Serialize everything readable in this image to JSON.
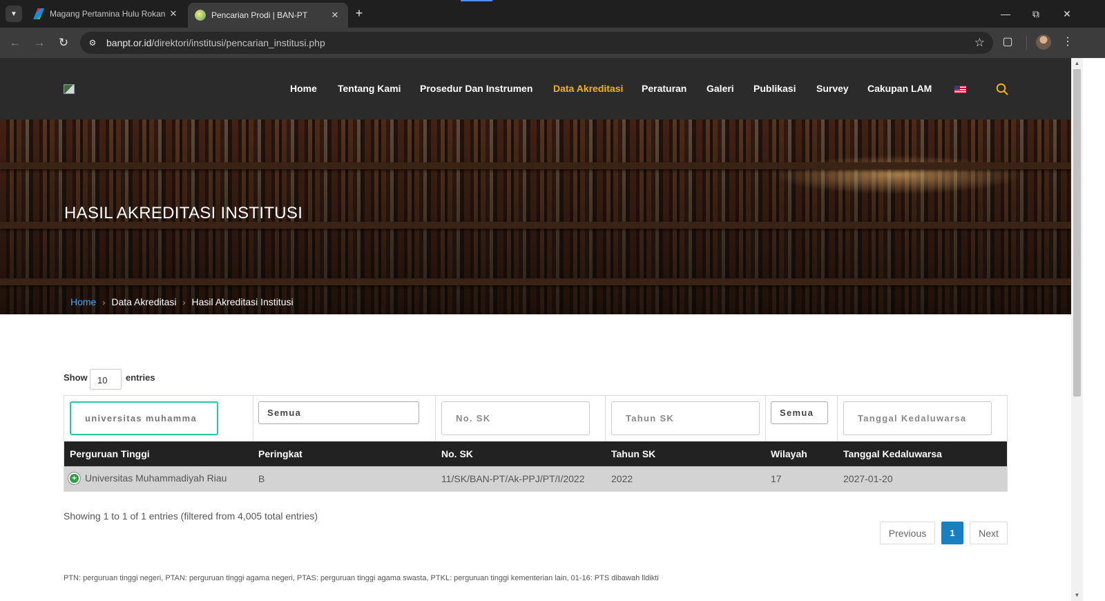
{
  "browser": {
    "tabs": [
      {
        "title": "Magang Pertamina Hulu Rokan",
        "active": false
      },
      {
        "title": "Pencarian Prodi | BAN-PT",
        "active": true
      }
    ],
    "new_tab": "+",
    "url_host": "banpt.or.id",
    "url_path": "/direktori/institusi/pencarian_institusi.php"
  },
  "site": {
    "nav": [
      "Home",
      "Tentang Kami",
      "Prosedur Dan Instrumen",
      "Data Akreditasi",
      "Peraturan",
      "Galeri",
      "Publikasi",
      "Survey",
      "Cakupan LAM"
    ],
    "active_nav": "Data Akreditasi",
    "accent_color": "#f5b301"
  },
  "hero": {
    "title": "HASIL AKREDITASI INSTITUSI",
    "breadcrumb": [
      "Home",
      "Data Akreditasi",
      "Hasil Akreditasi Institusi"
    ]
  },
  "table": {
    "show_label": "Show",
    "show_value": "10",
    "entries_label": "entries",
    "filters": {
      "perguruan_tinggi": "universitas muhamma",
      "peringkat": "Semua",
      "no_sk": "No. SK",
      "tahun_sk": "Tahun SK",
      "wilayah": "Semua",
      "tanggal": "Tanggal Kedaluwarsa"
    },
    "headers": [
      "Perguruan Tinggi",
      "Peringkat",
      "No. SK",
      "Tahun SK",
      "Wilayah",
      "Tanggal Kedaluwarsa"
    ],
    "rows": [
      {
        "perguruan_tinggi": "Universitas Muhammadiyah Riau",
        "peringkat": "B",
        "no_sk": "11/SK/BAN-PT/Ak-PPJ/PT/I/2022",
        "tahun_sk": "2022",
        "wilayah": "17",
        "tanggal": "2027-01-20"
      }
    ],
    "info": "Showing 1 to 1 of 1 entries (filtered from 4,005 total entries)",
    "pagination": {
      "previous": "Previous",
      "current": "1",
      "next": "Next"
    }
  },
  "footnote": "PTN: perguruan tinggi negeri, PTAN: perguruan tinggi agama negeri, PTAS: perguruan tinggi agama swasta, PTKL: perguruan tinggi kementerian lain, 01-16: PTS dibawah lldikti"
}
